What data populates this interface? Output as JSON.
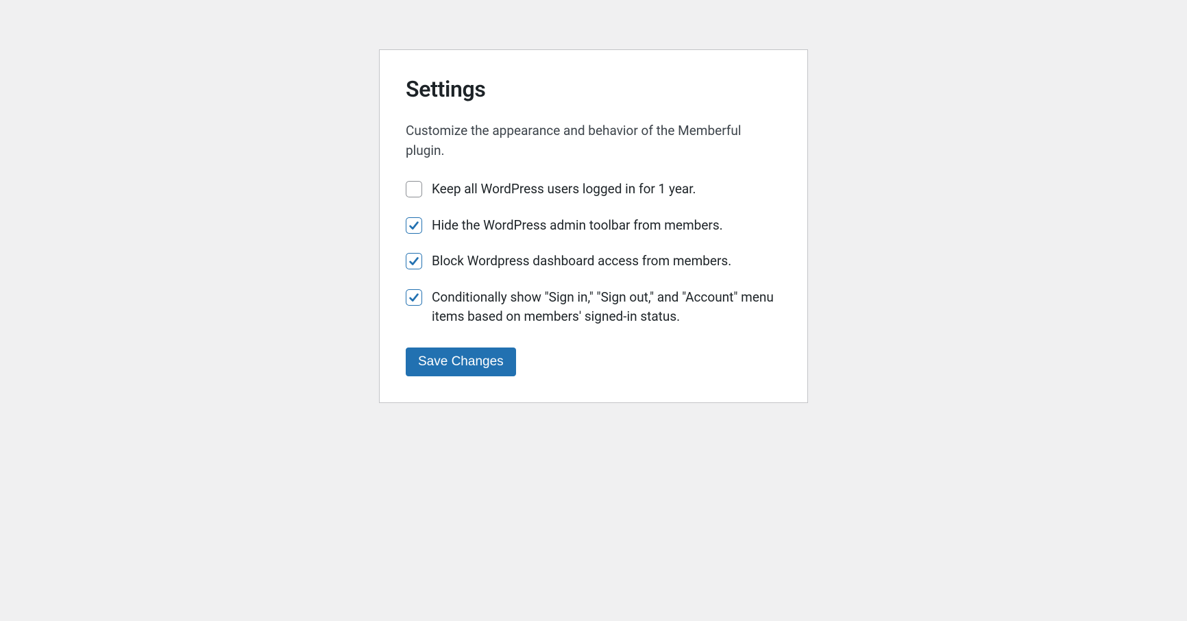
{
  "panel": {
    "title": "Settings",
    "description": "Customize the appearance and behavior of the Memberful plugin.",
    "options": [
      {
        "label": "Keep all WordPress users logged in for 1 year.",
        "checked": false
      },
      {
        "label": "Hide the WordPress admin toolbar from members.",
        "checked": true
      },
      {
        "label": "Block Wordpress dashboard access from members.",
        "checked": true
      },
      {
        "label": "Conditionally show \"Sign in,\" \"Sign out,\" and \"Account\" menu items based on members' signed-in status.",
        "checked": true
      }
    ],
    "save_label": "Save Changes"
  }
}
